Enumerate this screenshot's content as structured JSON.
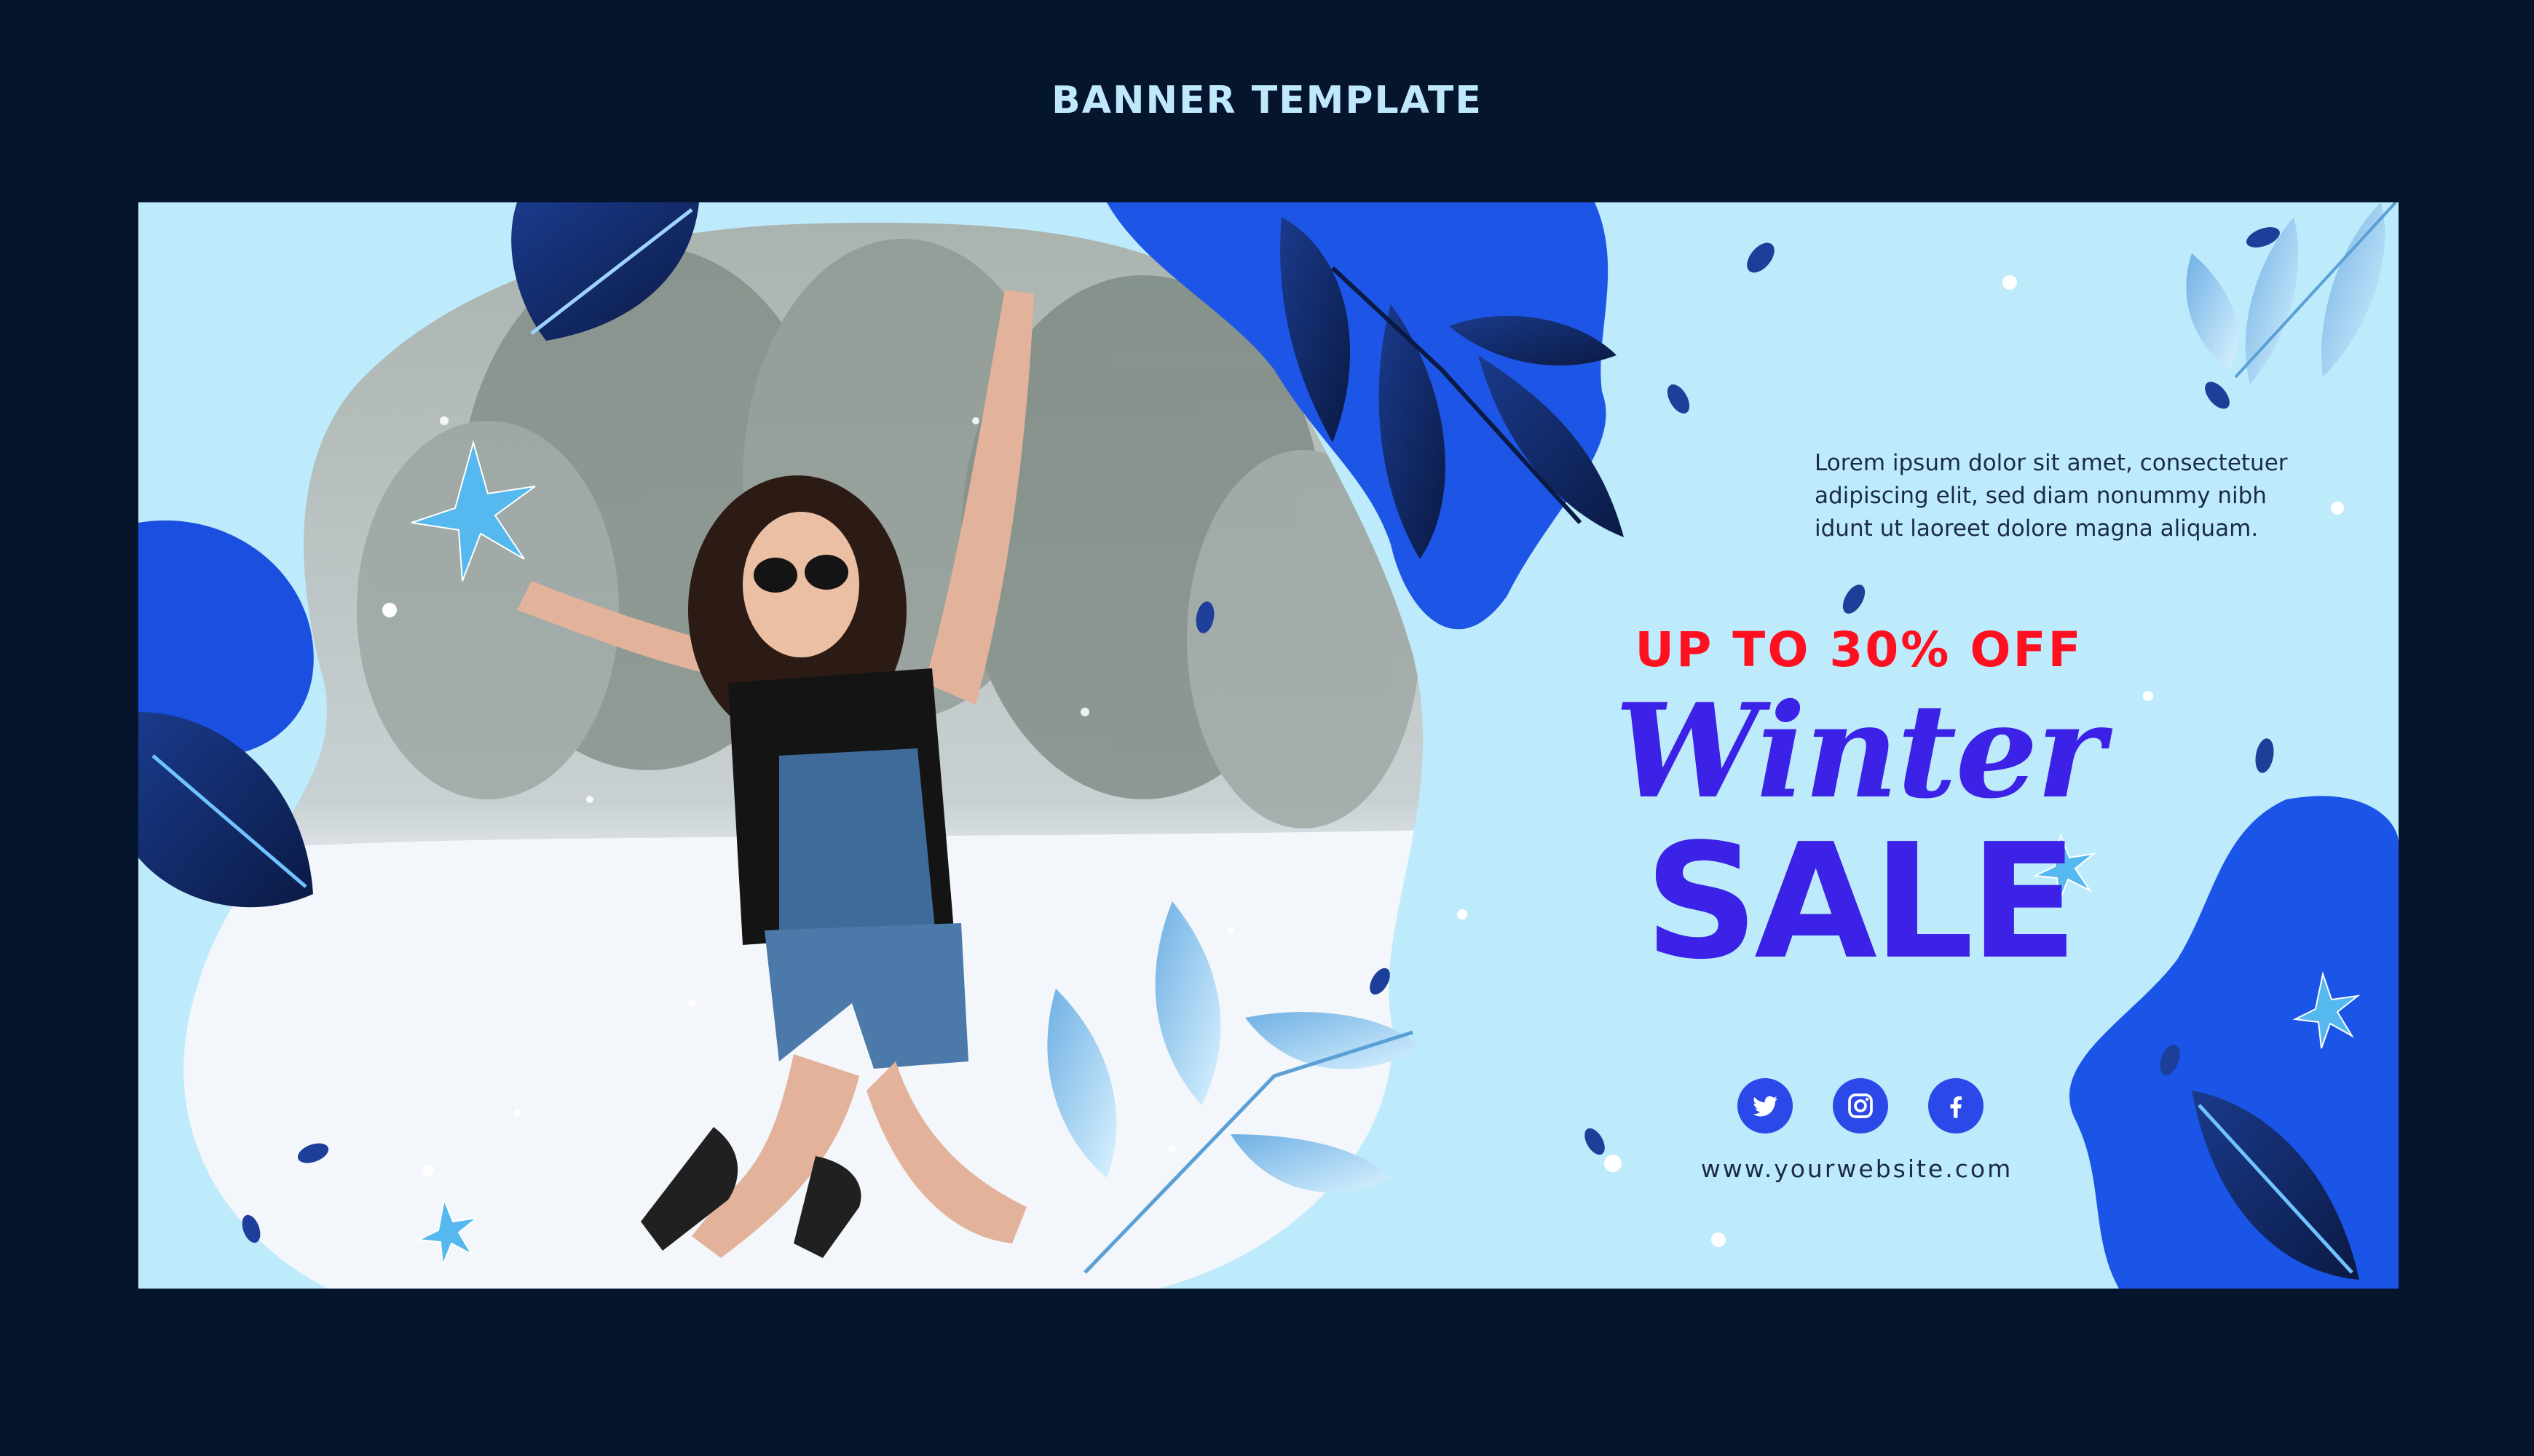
{
  "page": {
    "title": "BANNER TEMPLATE"
  },
  "banner": {
    "description_lines": [
      "Lorem ipsum dolor sit amet, consectetuer",
      "adipiscing elit, sed diam nonummy nibh",
      "idunt ut laoreet dolore magna aliquam."
    ],
    "promo": "UP TO 30% OFF",
    "headline_script": "Winter",
    "headline_block": "SALE",
    "socials": [
      {
        "icon": "twitter-icon"
      },
      {
        "icon": "instagram-icon"
      },
      {
        "icon": "facebook-icon"
      }
    ],
    "website": "www.yourwebsite.com",
    "photo": "woman-jumping-in-snow"
  },
  "colors": {
    "background": "#06152e",
    "banner_bg": "#bdebfb",
    "accent_blue": "#3b22e6",
    "promo_red": "#ff1020",
    "social_blue": "#2a49e8"
  }
}
